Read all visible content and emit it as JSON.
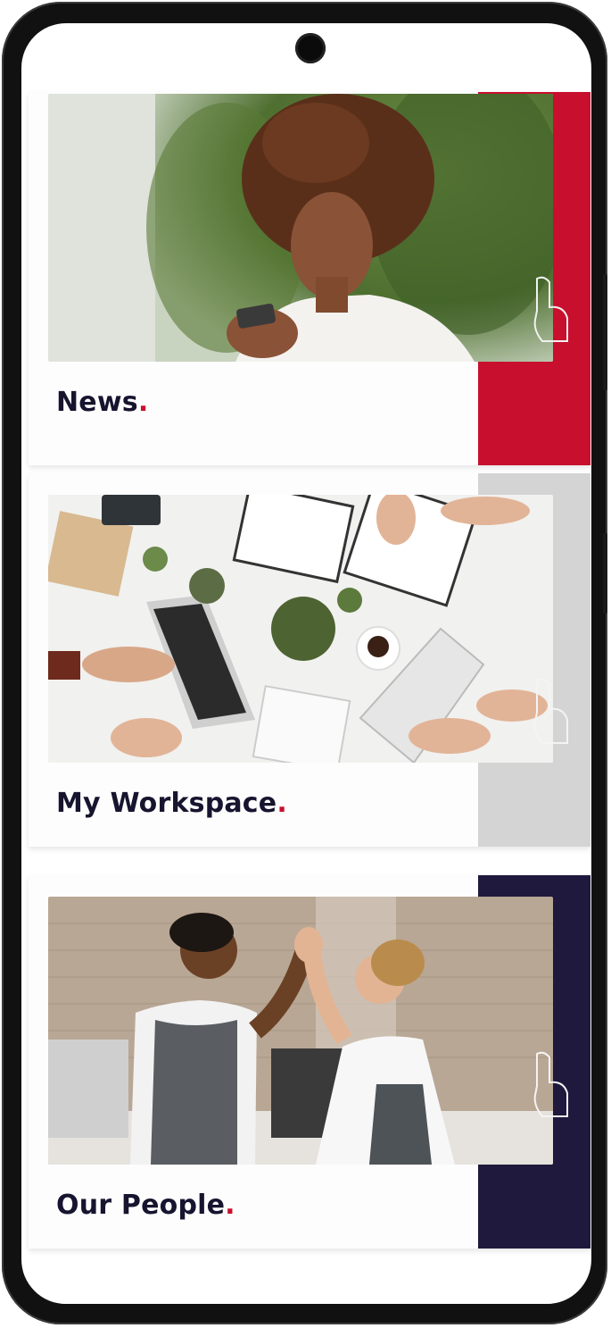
{
  "cards": [
    {
      "title": "News",
      "dot": ".",
      "photo": "woman-smiling-at-phone-photo"
    },
    {
      "title": "My Workspace",
      "dot": ".",
      "photo": "desk-workspace-laptops-photo"
    },
    {
      "title": "Our People",
      "dot": ".",
      "photo": "baristas-high-five-photo"
    }
  ],
  "colors": {
    "title": "#16142e",
    "dot": "#c8102e",
    "accent_news": "#c8102e",
    "accent_workspace": "#d4d4d4",
    "accent_people": "#1f1a3d"
  },
  "icons": [
    "camera-icon",
    "hand-tap-icon"
  ]
}
